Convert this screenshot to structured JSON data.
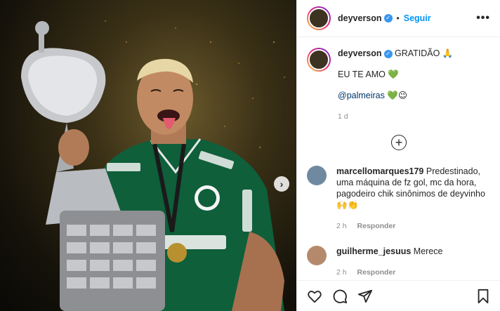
{
  "post": {
    "username": "deyverson",
    "follow_label": "Seguir",
    "separator": "•",
    "more_label": "•••",
    "caption": {
      "first_line": "GRATIDÃO 🙏",
      "second_line": "EU TE AMO 💚",
      "mention": "@palmeiras",
      "mention_emojis": "💚😉",
      "age": "1 d"
    },
    "load_more_label": "+"
  },
  "comments": [
    {
      "username": "marcellomarques179",
      "text": "Predestinado, uma máquina de fz gol, mc da hora, pagodeiro chik sinônimos de deyvinho 🙌👏",
      "time": "2 h",
      "reply_label": "Responder"
    },
    {
      "username": "guilherme_jesuus",
      "text": "Merece",
      "time": "2 h",
      "reply_label": "Responder"
    }
  ],
  "colors": {
    "link_blue": "#0095f6",
    "verified_blue": "#3897f0",
    "text_dark": "#262626",
    "text_gray": "#8e8e8e",
    "jersey_green": "#0e5f3a"
  },
  "icons": {
    "like": "heart-outline-icon",
    "comment": "comment-bubble-icon",
    "share": "paper-plane-icon",
    "save": "bookmark-icon",
    "next": "chevron-right-icon"
  }
}
